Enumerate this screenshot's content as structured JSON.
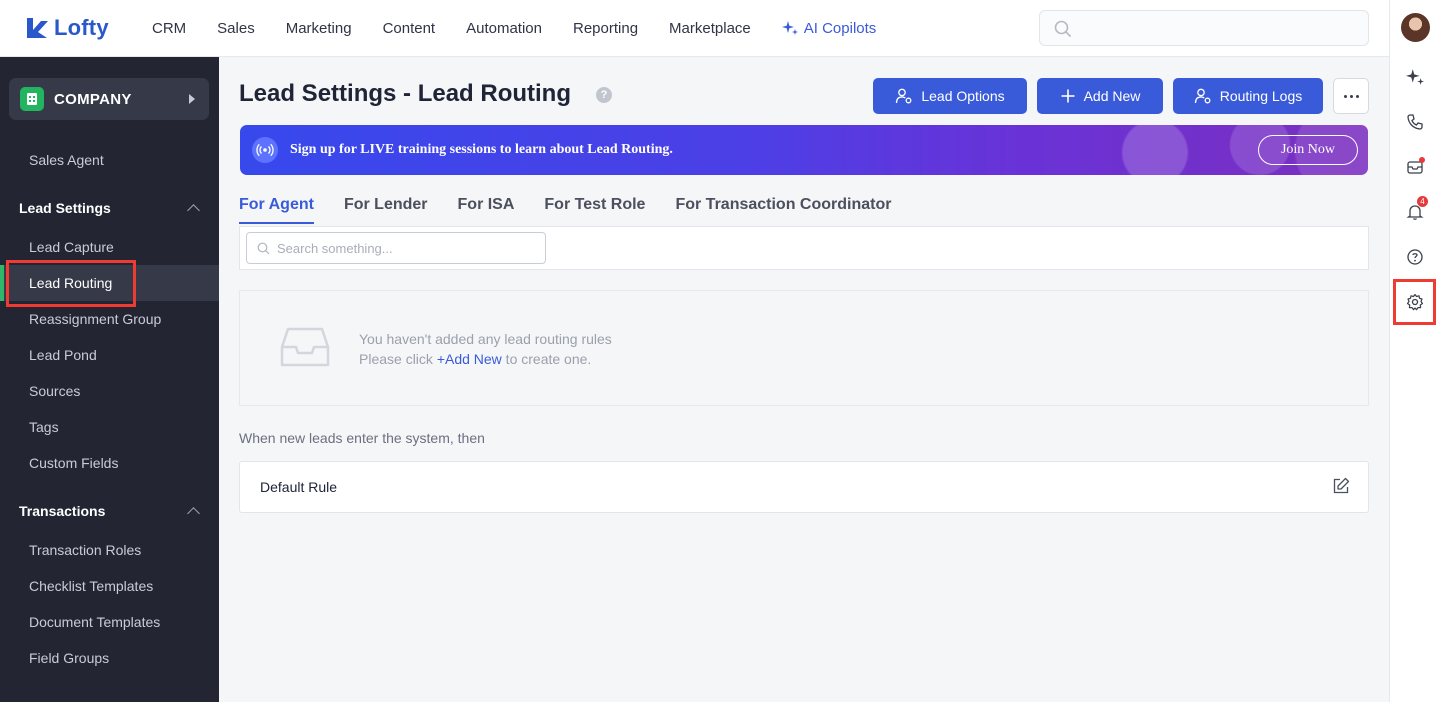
{
  "app": {
    "logo_text": "Lofty"
  },
  "nav": {
    "items": [
      "CRM",
      "Sales",
      "Marketing",
      "Content",
      "Automation",
      "Reporting",
      "Marketplace"
    ],
    "ai_label": "AI Copilots"
  },
  "sidebar": {
    "company_label": "COMPANY",
    "sales_agent": "Sales Agent",
    "lead_settings": {
      "heading": "Lead Settings",
      "items": [
        "Lead Capture",
        "Lead Routing",
        "Reassignment Group",
        "Lead Pond",
        "Sources",
        "Tags",
        "Custom Fields"
      ],
      "active": "Lead Routing"
    },
    "transactions": {
      "heading": "Transactions",
      "items": [
        "Transaction Roles",
        "Checklist Templates",
        "Document Templates",
        "Field Groups"
      ]
    }
  },
  "page": {
    "title": "Lead Settings - Lead Routing",
    "help_glyph": "?",
    "buttons": {
      "lead_options": "Lead Options",
      "add_new": "Add New",
      "routing_logs": "Routing Logs"
    },
    "banner": {
      "text": "Sign up for LIVE training sessions to learn about Lead Routing.",
      "button": "Join Now"
    },
    "tabs": [
      "For Agent",
      "For Lender",
      "For ISA",
      "For Test Role",
      "For Transaction Coordinator"
    ],
    "active_tab": "For Agent",
    "search_placeholder": "Search something...",
    "empty": {
      "line1": "You haven't added any lead routing rules",
      "line2_prefix": "Please click ",
      "line2_link": "+Add New",
      "line2_suffix": " to create one."
    },
    "note": "When new leads enter the system, then",
    "default_rule": "Default Rule"
  },
  "rail": {
    "notification_count": "4"
  },
  "colors": {
    "brand": "#2a57c9",
    "primary": "#3a5bd9",
    "sidebar_bg": "#232632",
    "active_green": "#2fb86a",
    "highlight_red": "#ef3b32"
  },
  "icons": [
    "logo-icon",
    "sparkle-icon",
    "search-icon",
    "phone-icon",
    "inbox-icon",
    "bell-icon",
    "help-icon",
    "gear-icon",
    "user-settings-icon",
    "plus-icon",
    "more-icon",
    "broadcast-icon",
    "empty-inbox-icon",
    "edit-icon",
    "chevron-up-icon",
    "chevron-right-icon"
  ]
}
